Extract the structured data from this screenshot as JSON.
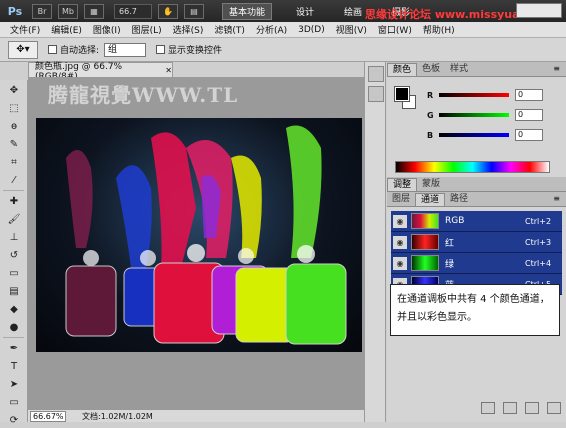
{
  "app": {
    "logo": "Ps",
    "bridge_label": "Br",
    "mini_label": "Mb",
    "zoom_value": "66.7",
    "workspaces": [
      "基本功能",
      "设计",
      "绘画",
      "摄影"
    ],
    "watermark": "思缘设计论坛 www.missyuan.com"
  },
  "menu": [
    "文件(F)",
    "编辑(E)",
    "图像(I)",
    "图层(L)",
    "选择(S)",
    "滤镜(T)",
    "分析(A)",
    "3D(D)",
    "视图(V)",
    "窗口(W)",
    "帮助(H)"
  ],
  "options": {
    "auto_select_label": "自动选择:",
    "auto_select_value": "组",
    "show_transform_label": "显示变换控件"
  },
  "document": {
    "tab_title": "颜色瓶.jpg @ 66.7%(RGB/8#)",
    "watermark_text": "腾龍視覺WWW.TL",
    "zoom_field": "66.67%",
    "doc_info": "文档:1.02M/1.02M"
  },
  "color_panel": {
    "tabs": [
      "颜色",
      "色板",
      "样式"
    ],
    "sliders": [
      {
        "label": "R",
        "value": "0",
        "color_from": "#000000",
        "color_to": "#ff0000"
      },
      {
        "label": "G",
        "value": "0",
        "color_from": "#000000",
        "color_to": "#00ff00"
      },
      {
        "label": "B",
        "value": "0",
        "color_from": "#000000",
        "color_to": "#0000ff"
      }
    ]
  },
  "adjust_panel": {
    "tabs": [
      "调整",
      "蒙版"
    ]
  },
  "channels_panel": {
    "tabs": [
      "图层",
      "通道",
      "路径"
    ],
    "channels": [
      {
        "name": "RGB",
        "shortcut": "Ctrl+2"
      },
      {
        "name": "红",
        "shortcut": "Ctrl+3"
      },
      {
        "name": "绿",
        "shortcut": "Ctrl+4"
      },
      {
        "name": "蓝",
        "shortcut": "Ctrl+5"
      }
    ]
  },
  "annotation": "在通道调板中共有 4 个颜色通道，并且以彩色显示。"
}
